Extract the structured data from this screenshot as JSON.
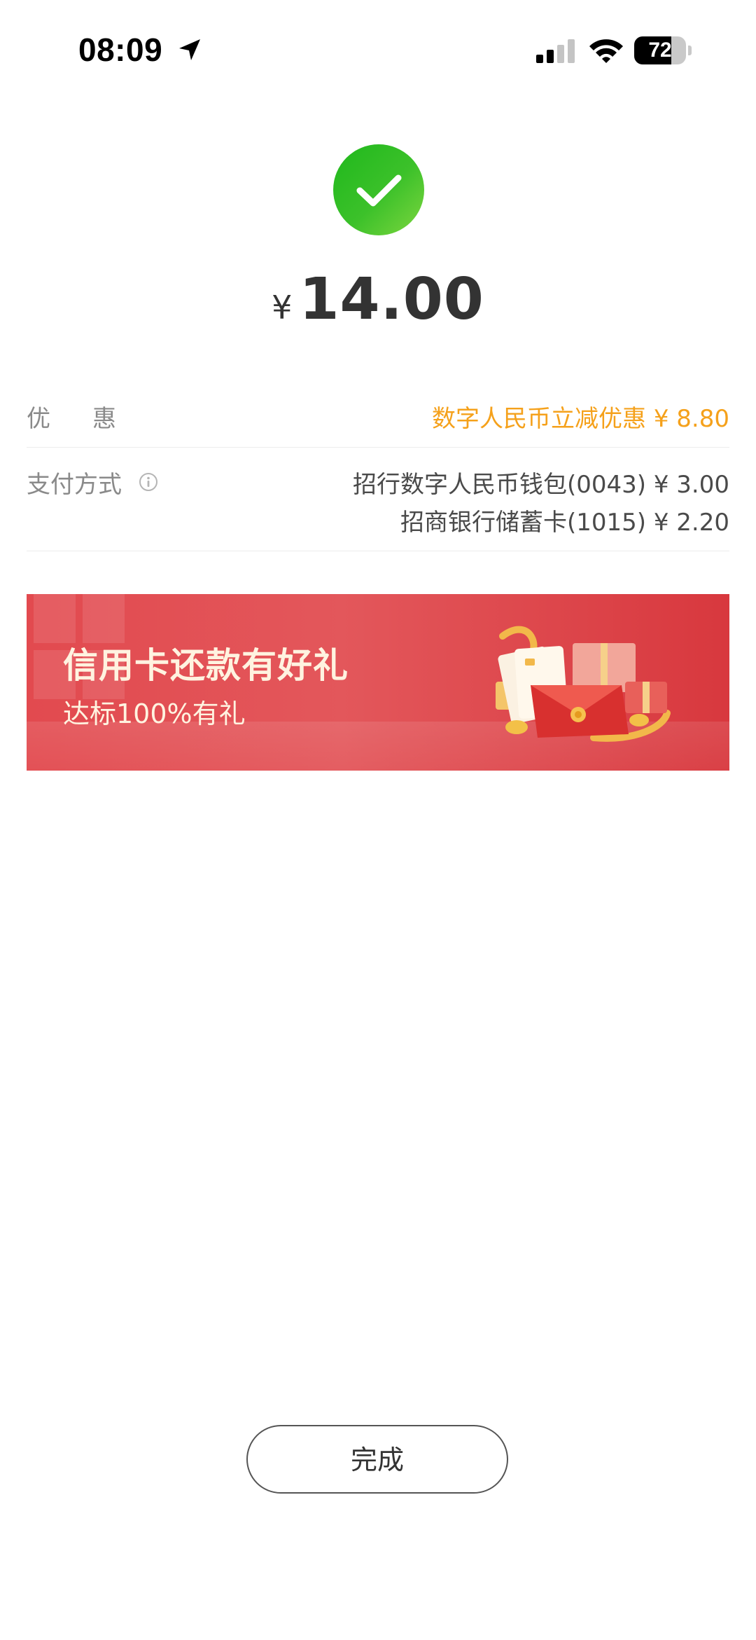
{
  "status_bar": {
    "time": "08:09",
    "battery_level": "72",
    "battery_fraction": 0.72
  },
  "payment": {
    "currency_symbol": "¥",
    "amount": "14.00"
  },
  "details": {
    "discount_label": "优惠",
    "discount_value": "数字人民币立减优惠 ¥ 8.80",
    "payment_method_label": "支付方式",
    "payment_methods": [
      "招行数字人民币钱包(0043) ¥ 3.00",
      "招商银行储蓄卡(1015) ¥ 2.20"
    ]
  },
  "banner": {
    "title": "信用卡还款有好礼",
    "subtitle": "达标100%有礼"
  },
  "actions": {
    "done_label": "完成"
  },
  "colors": {
    "success_green": "#2bbd24",
    "discount_orange": "#f5a11b",
    "banner_red": "#e24a4f"
  },
  "icons": {
    "location": "location-arrow-icon",
    "signal": "cellular-signal-icon",
    "wifi": "wifi-icon",
    "success": "checkmark-circle-icon",
    "info": "info-circle-icon",
    "gift": "gift-envelope-illustration"
  }
}
